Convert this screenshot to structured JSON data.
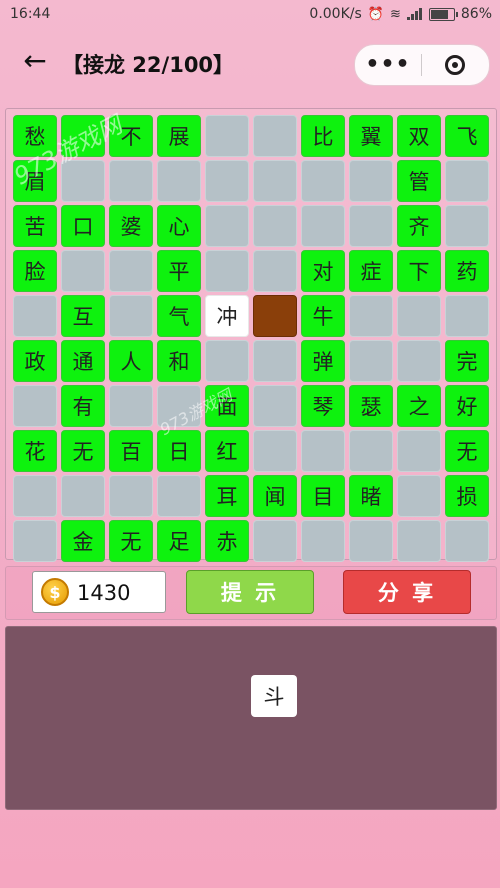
{
  "status_bar": {
    "time": "16:44",
    "network_speed": "0.00K/s",
    "battery": "86%",
    "battery_level": 0.86
  },
  "header": {
    "back_icon": "back-arrow-icon",
    "title": "【接龙 22/100】",
    "more_icon": "more-dots-icon",
    "record_icon": "target-circle-icon"
  },
  "colors": {
    "filled_cell": "#0ef20e",
    "empty_cell": "#b5c1c7",
    "selected_cell": "#ffffff",
    "target_cell": "#8a3f0a",
    "hint_button": "#8fd84a",
    "share_button": "#e84848"
  },
  "board": {
    "rows": 10,
    "cols": 10,
    "cells": [
      [
        "g:愁",
        "g:",
        "g:不",
        "g:展",
        "e",
        "e",
        "g:比",
        "g:翼",
        "g:双",
        "g:飞"
      ],
      [
        "g:眉",
        "e",
        "e",
        "e",
        "e",
        "e",
        "e",
        "e",
        "g:管",
        "e"
      ],
      [
        "g:苦",
        "g:口",
        "g:婆",
        "g:心",
        "e",
        "e",
        "e",
        "e",
        "g:齐",
        "e"
      ],
      [
        "g:脸",
        "e",
        "e",
        "g:平",
        "e",
        "e",
        "g:对",
        "g:症",
        "g:下",
        "g:药"
      ],
      [
        "e",
        "g:互",
        "e",
        "g:气",
        "w:冲",
        "b",
        "g:牛",
        "e",
        "e",
        "e"
      ],
      [
        "g:政",
        "g:通",
        "g:人",
        "g:和",
        "e",
        "e",
        "g:弹",
        "e",
        "e",
        "g:完"
      ],
      [
        "e",
        "g:有",
        "e",
        "e",
        "g:面",
        "e",
        "g:琴",
        "g:瑟",
        "g:之",
        "g:好"
      ],
      [
        "g:花",
        "g:无",
        "g:百",
        "g:日",
        "g:红",
        "e",
        "e",
        "e",
        "e",
        "g:无"
      ],
      [
        "e",
        "e",
        "e",
        "e",
        "g:耳",
        "g:闻",
        "g:目",
        "g:睹",
        "e",
        "g:损"
      ],
      [
        "e",
        "g:金",
        "g:无",
        "g:足",
        "g:赤",
        "e",
        "e",
        "e",
        "e",
        "e"
      ]
    ]
  },
  "controls": {
    "coin_icon": "coin-icon",
    "coin_symbol": "$",
    "coins": "1430",
    "hint_label": "提 示",
    "share_label": "分 享"
  },
  "pool": {
    "options": [
      "斗"
    ]
  },
  "watermarks": [
    "973游戏网",
    "973游戏网"
  ]
}
